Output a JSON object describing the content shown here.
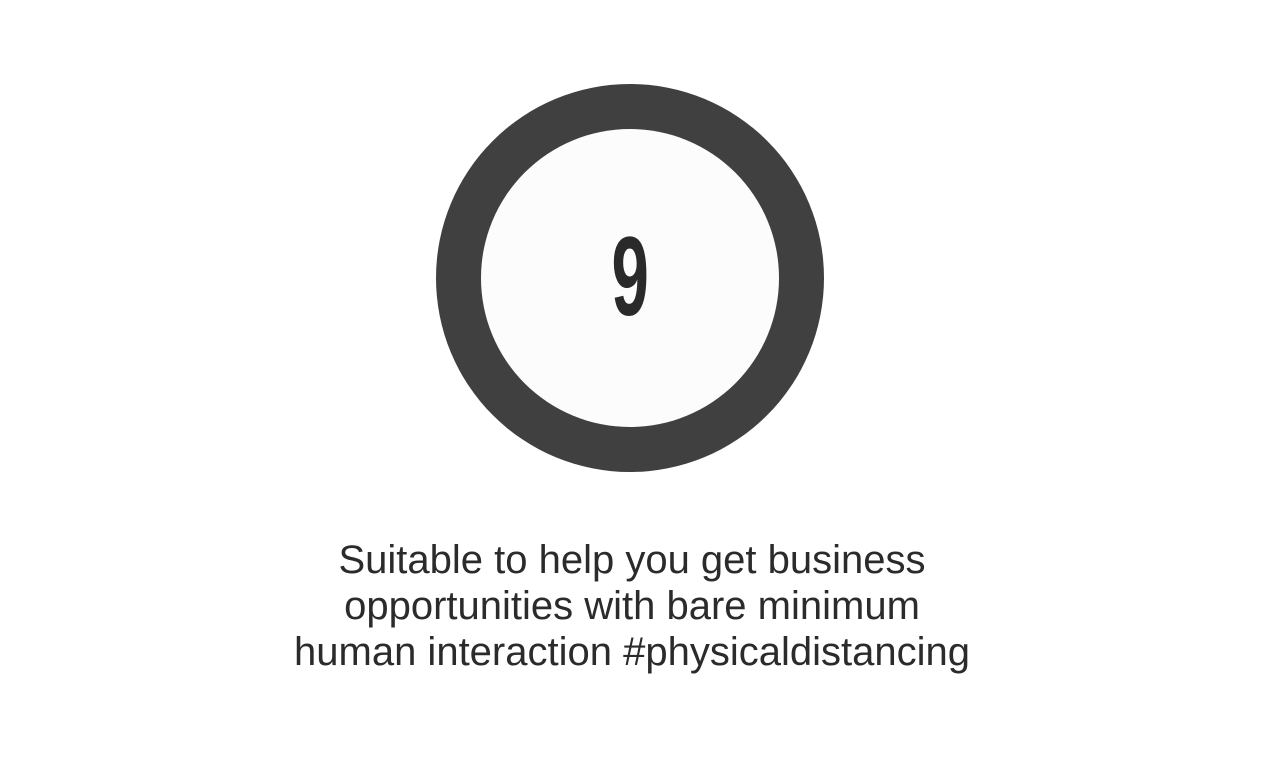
{
  "badge": {
    "number": "9"
  },
  "caption": {
    "lines": [
      "Suitable to help you get business",
      "opportunities with bare minimum",
      "human interaction #physicaldistancing"
    ]
  },
  "colors": {
    "ring": "#404040",
    "ring_fill": "#fcfcfc",
    "text": "#2b2b2b"
  }
}
